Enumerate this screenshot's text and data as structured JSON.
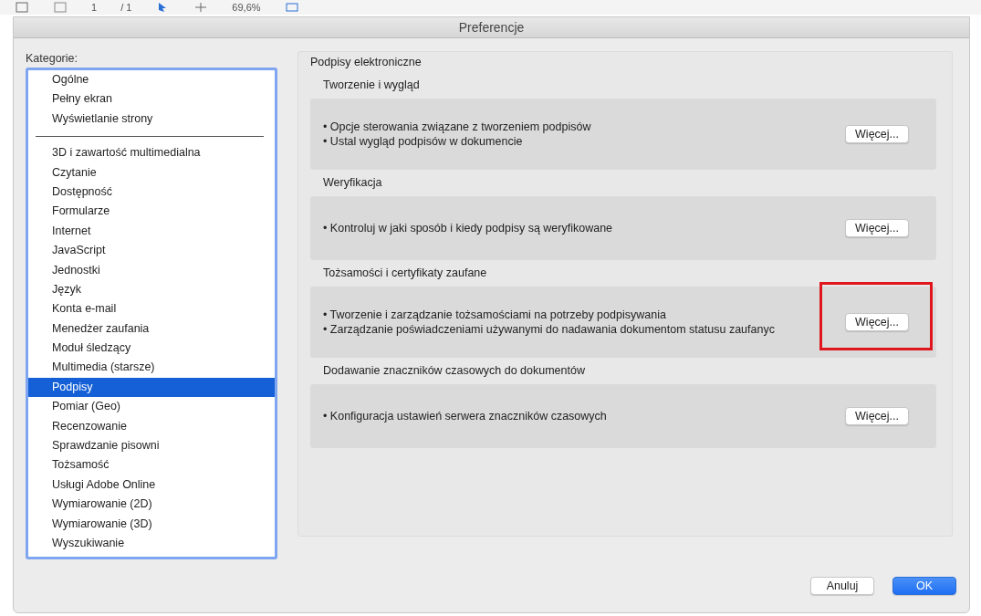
{
  "toolbar": {
    "page_number": "1",
    "page_total": "/ 1",
    "zoom": "69,6%"
  },
  "window": {
    "title": "Preferencje"
  },
  "sidebar": {
    "label": "Kategorie:",
    "items": [
      {
        "label": "Ogólne",
        "selected": false
      },
      {
        "label": "Pełny ekran",
        "selected": false
      },
      {
        "label": "Wyświetlanie strony",
        "selected": false
      },
      {
        "kind": "separator"
      },
      {
        "label": "3D i zawartość multimedialna",
        "selected": false
      },
      {
        "label": "Czytanie",
        "selected": false
      },
      {
        "label": "Dostępność",
        "selected": false
      },
      {
        "label": "Formularze",
        "selected": false
      },
      {
        "label": "Internet",
        "selected": false
      },
      {
        "label": "JavaScript",
        "selected": false
      },
      {
        "label": "Jednostki",
        "selected": false
      },
      {
        "label": "Język",
        "selected": false
      },
      {
        "label": "Konta e-mail",
        "selected": false
      },
      {
        "label": "Menedżer zaufania",
        "selected": false
      },
      {
        "label": "Moduł śledzący",
        "selected": false
      },
      {
        "label": "Multimedia (starsze)",
        "selected": false
      },
      {
        "label": "Podpisy",
        "selected": true
      },
      {
        "label": "Pomiar (Geo)",
        "selected": false
      },
      {
        "label": "Recenzowanie",
        "selected": false
      },
      {
        "label": "Sprawdzanie pisowni",
        "selected": false
      },
      {
        "label": "Tożsamość",
        "selected": false
      },
      {
        "label": "Usługi Adobe Online",
        "selected": false
      },
      {
        "label": "Wymiarowanie (2D)",
        "selected": false
      },
      {
        "label": "Wymiarowanie (3D)",
        "selected": false
      },
      {
        "label": "Wyszukiwanie",
        "selected": false
      }
    ]
  },
  "panel": {
    "title": "Podpisy elektroniczne",
    "sections": [
      {
        "title": "Tworzenie i wygląd",
        "bullets": [
          "• Opcje sterowania związane z tworzeniem podpisów",
          "• Ustal wygląd podpisów w dokumencie"
        ],
        "button": "Więcej...",
        "highlighted": false
      },
      {
        "title": "Weryfikacja",
        "bullets": [
          "• Kontroluj w jaki sposób i kiedy podpisy są weryfikowane"
        ],
        "button": "Więcej...",
        "highlighted": false
      },
      {
        "title": "Tożsamości i certyfikaty zaufane",
        "bullets": [
          "• Tworzenie i zarządzanie tożsamościami na potrzeby podpisywania",
          "• Zarządzanie poświadczeniami używanymi do nadawania dokumentom statusu zaufanyc"
        ],
        "button": "Więcej...",
        "highlighted": true
      },
      {
        "title": "Dodawanie znaczników czasowych do dokumentów",
        "bullets": [
          "• Konfiguracja ustawień serwera znaczników czasowych"
        ],
        "button": "Więcej...",
        "highlighted": false
      }
    ]
  },
  "buttons": [
    {
      "label": "Anuluj",
      "kind": "secondary"
    },
    {
      "label": "OK",
      "kind": "primary"
    }
  ]
}
